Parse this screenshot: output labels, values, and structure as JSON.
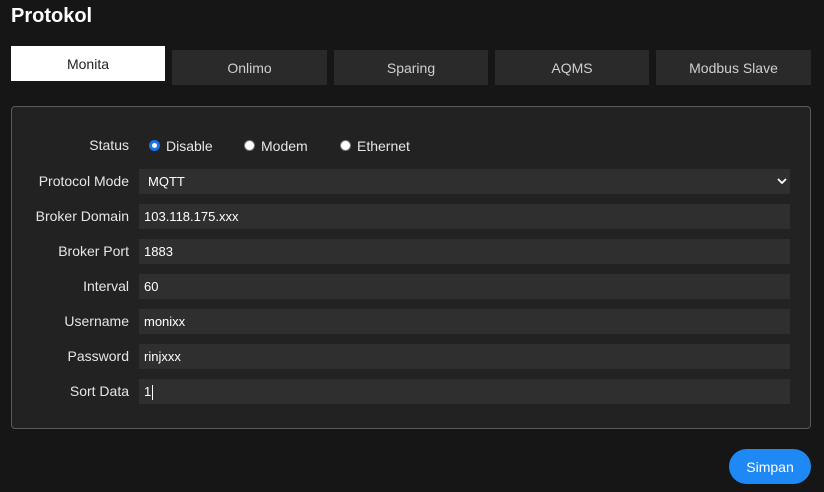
{
  "page": {
    "title": "Protokol"
  },
  "tabs": [
    {
      "label": "Monita",
      "active": true
    },
    {
      "label": "Onlimo",
      "active": false
    },
    {
      "label": "Sparing",
      "active": false
    },
    {
      "label": "AQMS",
      "active": false
    },
    {
      "label": "Modbus Slave",
      "active": false
    }
  ],
  "form": {
    "status": {
      "label": "Status",
      "options": [
        "Disable",
        "Modem",
        "Ethernet"
      ],
      "selected": "Disable"
    },
    "protocol_mode": {
      "label": "Protocol Mode",
      "value": "MQTT"
    },
    "broker_domain": {
      "label": "Broker Domain",
      "value": "103.118.175.xxx"
    },
    "broker_port": {
      "label": "Broker Port",
      "value": "1883"
    },
    "interval": {
      "label": "Interval",
      "value": "60"
    },
    "username": {
      "label": "Username",
      "value": "monixx"
    },
    "password": {
      "label": "Password",
      "value": "rinjxxx"
    },
    "sort_data": {
      "label": "Sort Data",
      "value": "1"
    }
  },
  "actions": {
    "save_label": "Simpan"
  },
  "colors": {
    "accent": "#1e88f5",
    "background": "#161616",
    "panel": "#222222",
    "field": "#2f2f2f"
  }
}
